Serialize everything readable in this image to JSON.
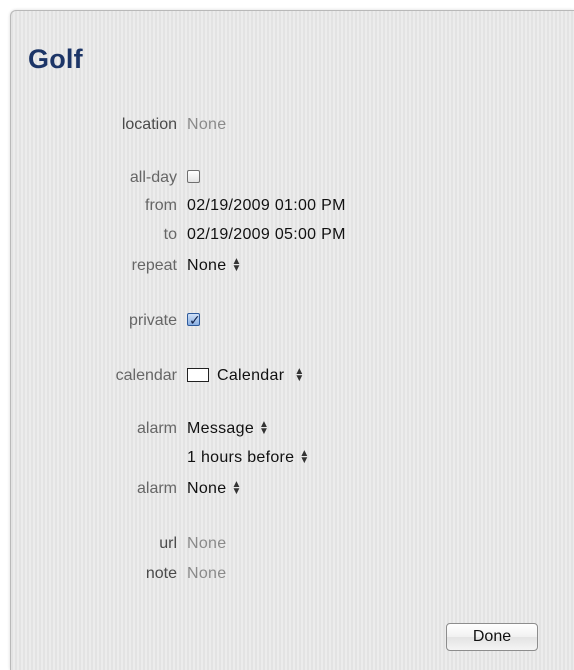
{
  "event": {
    "title": "Golf"
  },
  "fields": {
    "location": {
      "label": "location",
      "value": "None"
    },
    "all_day": {
      "label": "all-day",
      "checked": false
    },
    "from": {
      "label": "from",
      "value": "02/19/2009 01:00 PM"
    },
    "to": {
      "label": "to",
      "value": "02/19/2009 05:00 PM"
    },
    "repeat": {
      "label": "repeat",
      "value": "None"
    },
    "private": {
      "label": "private",
      "checked": true
    },
    "calendar": {
      "label": "calendar",
      "value": "Calendar",
      "swatch_color": "#ffffff"
    },
    "alarm1": {
      "label": "alarm",
      "value": "Message",
      "timing": "1 hours before"
    },
    "alarm2": {
      "label": "alarm",
      "value": "None"
    },
    "url": {
      "label": "url",
      "value": "None"
    },
    "note": {
      "label": "note",
      "value": "None"
    }
  },
  "actions": {
    "done_label": "Done"
  },
  "colors": {
    "title": "#1c3567",
    "label": "#666666",
    "placeholder": "#8a8a8a"
  }
}
